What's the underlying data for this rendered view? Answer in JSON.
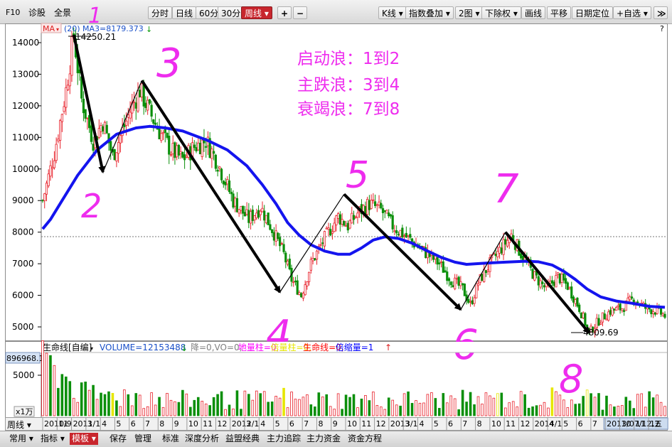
{
  "toolbar": {
    "f10": "F10",
    "diagnose": "诊股",
    "full_view": "全景",
    "periods": [
      "分时",
      "日线",
      "60分",
      "30分",
      "周线"
    ],
    "active_period": "周线",
    "zoom_in": "+",
    "zoom_out": "−",
    "kline_type": "K线",
    "index_overlay": "指数叠加",
    "two_charts": "2图",
    "ex_right": "下除权",
    "draw_line": "画线",
    "pan": "平移",
    "date_locate": "日期定位",
    "add_watchlist": "+自选",
    "end": "≫"
  },
  "price_chart": {
    "ma_button": "MA",
    "ma_period": "(20)",
    "ma3_label": "MA3=8179.373",
    "question": "?",
    "high_label": "14250.21",
    "low_label": "4809.69",
    "y_ticks": [
      "14000",
      "13000",
      "12000",
      "11000",
      "10000",
      "9000",
      "8000",
      "7000",
      "6000",
      "5000"
    ],
    "notes": [
      "启动浪：1到2",
      "主跌浪：3到4",
      "衰竭浪：7到8"
    ],
    "wave_numbers": [
      "1",
      "2",
      "3",
      "4",
      "5",
      "6",
      "7",
      "8"
    ]
  },
  "volume_chart": {
    "indicator_name": "生命线[自编]",
    "volume_label": "VOLUME=12153488",
    "legend": [
      {
        "text": "降=0,VO=0,",
        "color": "#808080"
      },
      {
        "text": "地量柱=0,",
        "color": "#ff00ff"
      },
      {
        "text": "倍量柱=0,",
        "color": "#e6e600"
      },
      {
        "text": "生命线=0,",
        "color": "#ff0000"
      },
      {
        "text": "倍缩量=1",
        "color": "#0000ff"
      }
    ],
    "max_value": "896968.1",
    "mid_tick": "5000",
    "unit": "x1万"
  },
  "x_axis": {
    "period_label": "周线",
    "labels": [
      "2010/9",
      "11",
      "2011/1",
      "3",
      "4",
      "5",
      "6",
      "7",
      "8",
      "9",
      "10",
      "11",
      "12",
      "2012/1",
      "3",
      "4",
      "5",
      "6",
      "7",
      "8",
      "9",
      "10",
      "11",
      "12",
      "2013/1",
      "3",
      "4",
      "5",
      "6",
      "7",
      "8",
      "10",
      "11",
      "12",
      "2014/1",
      "4",
      "5",
      "6",
      "7",
      "2013/07/12,五",
      "10",
      "11",
      "12"
    ],
    "cursor_date": "2013/07/12,五"
  },
  "bottom_tabs": [
    "常用",
    "指标",
    "模板",
    "保存",
    "管理",
    "标准",
    "深度分析",
    "益盟经典",
    "主力追踪",
    "主力资金",
    "资金方程"
  ],
  "active_bottom_tab": "模板",
  "chart_data": {
    "type": "candlestick",
    "period": "weekly",
    "ylim": [
      4600,
      14500
    ],
    "price_path": [
      [
        0,
        9000
      ],
      [
        6,
        10500
      ],
      [
        12,
        12500
      ],
      [
        16,
        14250
      ],
      [
        20,
        12200
      ],
      [
        26,
        10900
      ],
      [
        31,
        11500
      ],
      [
        36,
        10400
      ],
      [
        41,
        11200
      ],
      [
        46,
        12000
      ],
      [
        50,
        12500
      ],
      [
        55,
        11800
      ],
      [
        60,
        11200
      ],
      [
        66,
        10600
      ],
      [
        72,
        10300
      ],
      [
        78,
        10700
      ],
      [
        84,
        10900
      ],
      [
        90,
        10200
      ],
      [
        98,
        9000
      ],
      [
        106,
        8400
      ],
      [
        112,
        8800
      ],
      [
        118,
        8100
      ],
      [
        124,
        7300
      ],
      [
        128,
        6500
      ],
      [
        133,
        6000
      ],
      [
        138,
        7000
      ],
      [
        145,
        7800
      ],
      [
        152,
        8500
      ],
      [
        157,
        8200
      ],
      [
        162,
        8600
      ],
      [
        168,
        8900
      ],
      [
        174,
        8700
      ],
      [
        180,
        8200
      ],
      [
        188,
        7800
      ],
      [
        196,
        7400
      ],
      [
        204,
        7000
      ],
      [
        210,
        6500
      ],
      [
        216,
        6200
      ],
      [
        220,
        5700
      ],
      [
        224,
        6400
      ],
      [
        230,
        7000
      ],
      [
        236,
        7500
      ],
      [
        241,
        7900
      ],
      [
        247,
        7200
      ],
      [
        253,
        6600
      ],
      [
        259,
        6200
      ],
      [
        265,
        6600
      ],
      [
        270,
        6300
      ],
      [
        276,
        5600
      ],
      [
        281,
        4810
      ],
      [
        286,
        5200
      ],
      [
        292,
        5500
      ],
      [
        298,
        5600
      ],
      [
        304,
        5900
      ],
      [
        310,
        5600
      ],
      [
        316,
        5500
      ],
      [
        320,
        5350
      ]
    ],
    "ma_line": [
      [
        0,
        8100
      ],
      [
        4,
        8400
      ],
      [
        10,
        9000
      ],
      [
        18,
        9800
      ],
      [
        28,
        10600
      ],
      [
        38,
        11100
      ],
      [
        48,
        11300
      ],
      [
        55,
        11350
      ],
      [
        63,
        11300
      ],
      [
        72,
        11200
      ],
      [
        85,
        10900
      ],
      [
        95,
        10600
      ],
      [
        105,
        10100
      ],
      [
        113,
        9500
      ],
      [
        120,
        8900
      ],
      [
        126,
        8300
      ],
      [
        132,
        7900
      ],
      [
        138,
        7600
      ],
      [
        145,
        7400
      ],
      [
        152,
        7300
      ],
      [
        158,
        7300
      ],
      [
        164,
        7500
      ],
      [
        170,
        7750
      ],
      [
        176,
        7850
      ],
      [
        183,
        7800
      ],
      [
        190,
        7650
      ],
      [
        198,
        7400
      ],
      [
        205,
        7200
      ],
      [
        212,
        7050
      ],
      [
        218,
        6980
      ],
      [
        228,
        7020
      ],
      [
        238,
        7050
      ],
      [
        248,
        7080
      ],
      [
        255,
        7060
      ],
      [
        262,
        6960
      ],
      [
        268,
        6760
      ],
      [
        274,
        6500
      ],
      [
        280,
        6200
      ],
      [
        287,
        5950
      ],
      [
        295,
        5820
      ],
      [
        303,
        5750
      ],
      [
        312,
        5650
      ],
      [
        320,
        5620
      ]
    ],
    "reference_line": 7870,
    "high": 14250.21,
    "low": 4809.69,
    "ma3": 8179.373,
    "waves": [
      {
        "label": "1",
        "index": 16,
        "price": 14250
      },
      {
        "label": "2",
        "index": 31,
        "price": 9900
      },
      {
        "label": "3",
        "index": 51,
        "price": 12800
      },
      {
        "label": "4",
        "index": 122,
        "price": 6100
      },
      {
        "label": "5",
        "index": 155,
        "price": 9200
      },
      {
        "label": "6",
        "index": 215,
        "price": 5550
      },
      {
        "label": "7",
        "index": 238,
        "price": 8000
      },
      {
        "label": "8",
        "index": 281,
        "price": 4810
      }
    ],
    "volume_ymax": 896968.1,
    "highlight_volume_indices": [
      3,
      37,
      125,
      234,
      262,
      280
    ]
  }
}
